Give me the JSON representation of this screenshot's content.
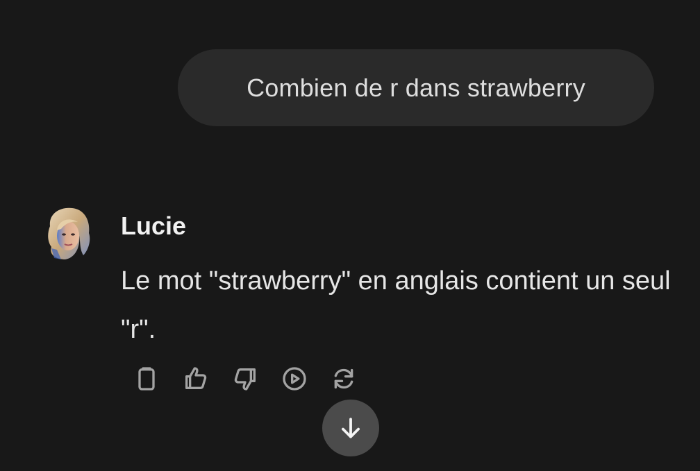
{
  "conversation": {
    "user_message": "Combien de r dans strawberry",
    "assistant": {
      "name": "Lucie",
      "message": "Le mot \"strawberry\" en anglais contient un seul \"r\".",
      "avatar_icon": "lucie-avatar-icon"
    }
  },
  "actions": [
    {
      "name": "copy",
      "icon": "clipboard-icon"
    },
    {
      "name": "like",
      "icon": "thumbs-up-icon"
    },
    {
      "name": "dislike",
      "icon": "thumbs-down-icon"
    },
    {
      "name": "read-aloud",
      "icon": "play-circle-icon"
    },
    {
      "name": "regenerate",
      "icon": "refresh-icon"
    }
  ],
  "scroll_button": {
    "icon": "arrow-down-icon"
  },
  "colors": {
    "background": "#181818",
    "user_bubble": "#2a2a2a",
    "scroll_button": "#4b4b4b",
    "icon": "#a3a3a3"
  }
}
